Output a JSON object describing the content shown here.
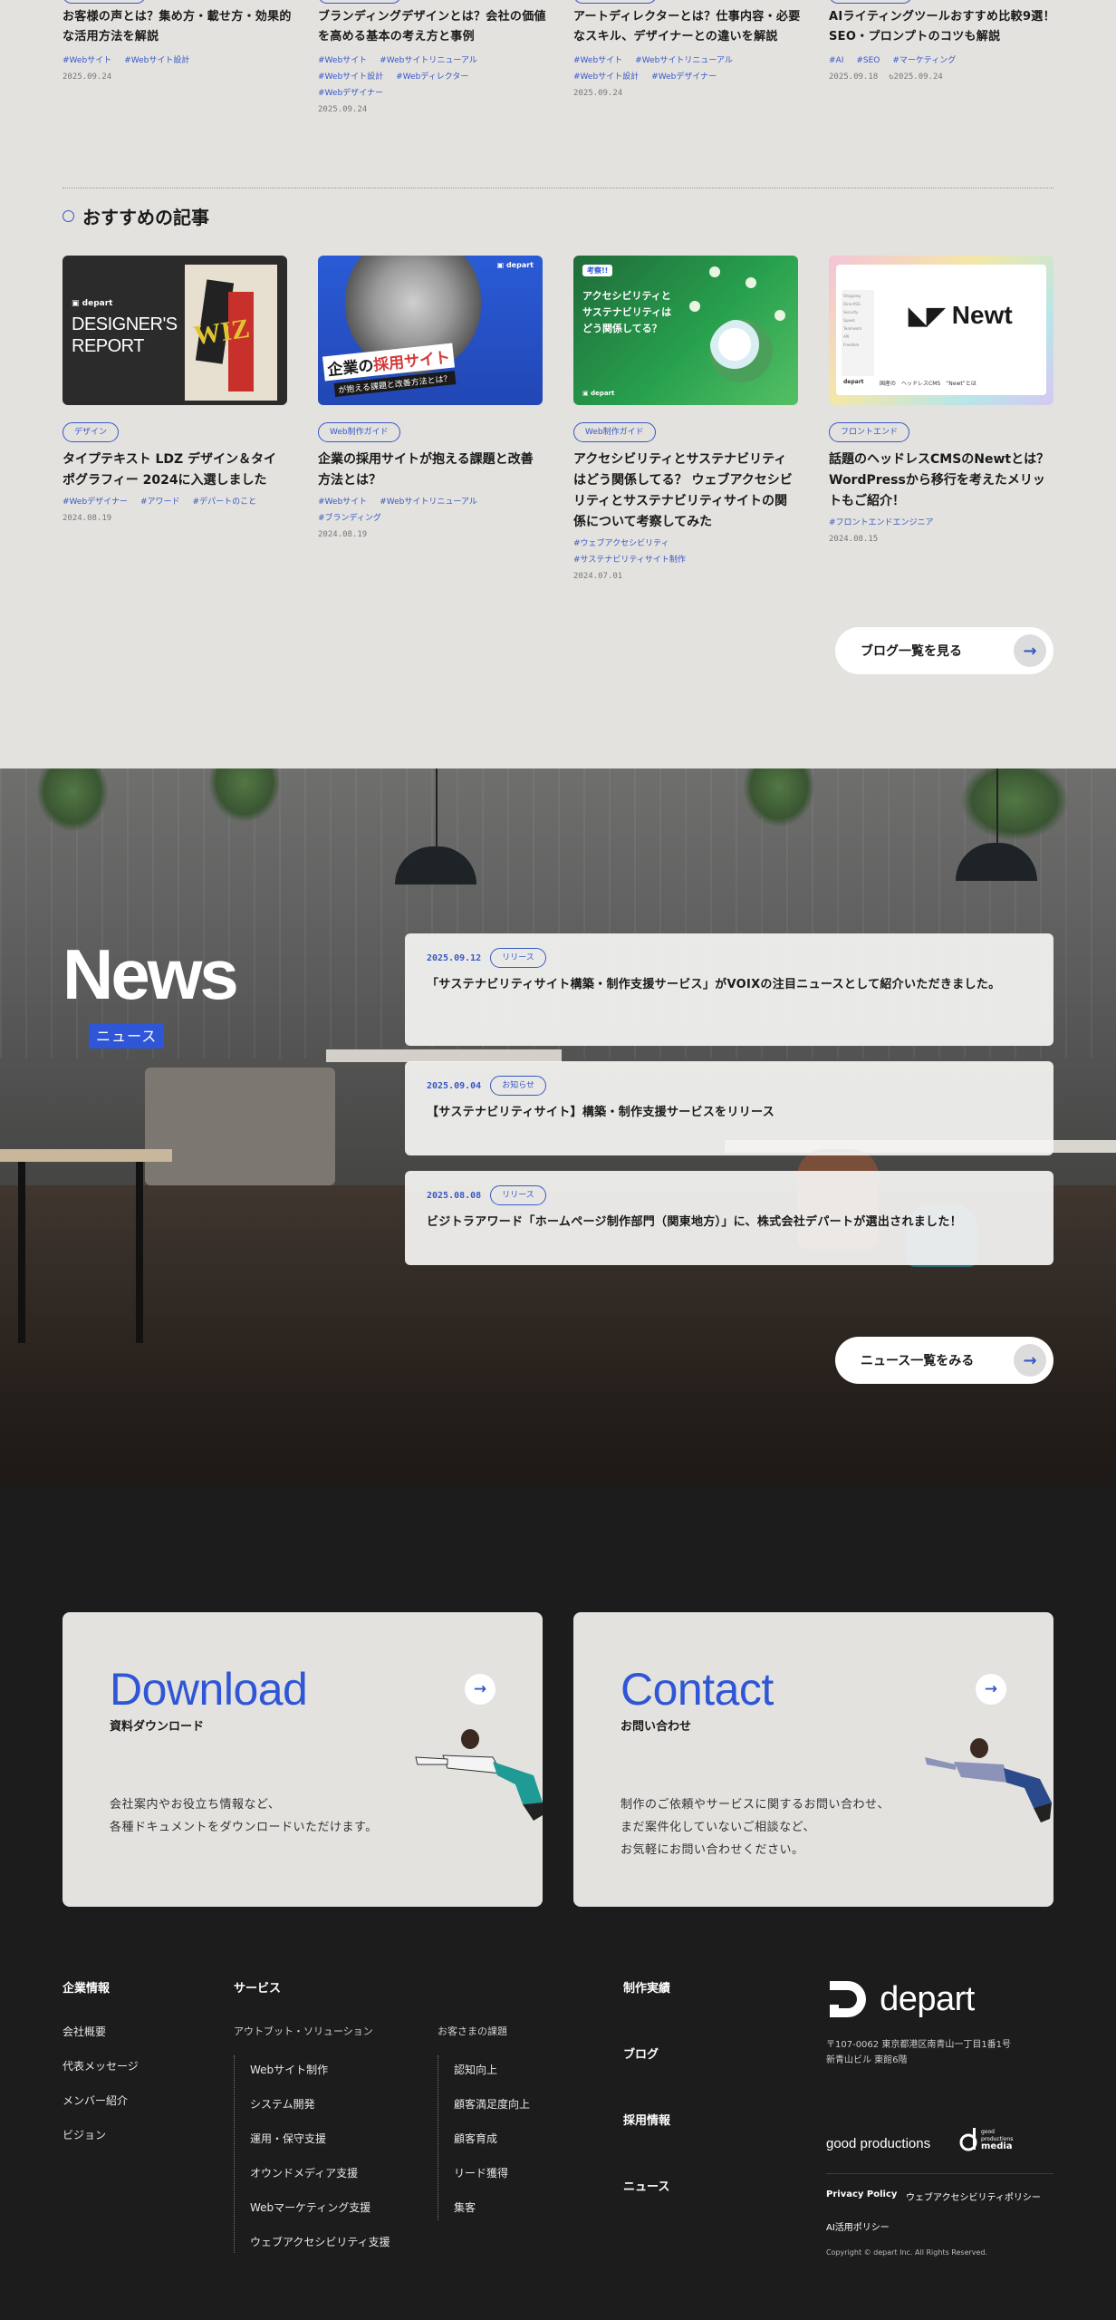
{
  "top_articles": [
    {
      "title": "お客様の声とは？集め方・載せ方・効果的な活用方法を解説",
      "tags": [
        "#Webサイト",
        "#Webサイト設計"
      ],
      "date": "2025.09.24",
      "updated": ""
    },
    {
      "title": "ブランディングデザインとは？会社の価値を高める基本の考え方と事例",
      "tags": [
        "#Webサイト",
        "#Webサイトリニューアル",
        "#Webサイト設計",
        "#Webディレクター",
        "#Webデザイナー"
      ],
      "date": "2025.09.24",
      "updated": ""
    },
    {
      "title": "アートディレクターとは？仕事内容・必要なスキル、デザイナーとの違いを解説",
      "tags": [
        "#Webサイト",
        "#Webサイトリニューアル",
        "#Webサイト設計",
        "#Webデザイナー"
      ],
      "date": "2025.09.24",
      "updated": ""
    },
    {
      "title": "AIライティングツールおすすめ比較9選！SEO・プロンプトのコツも解説",
      "tags": [
        "#AI",
        "#SEO",
        "#マーケティング"
      ],
      "date": "2025.09.18",
      "updated": "2025.09.24"
    }
  ],
  "recommended": {
    "heading": "おすすめの記事",
    "items": [
      {
        "category": "デザイン",
        "title": "タイプテキスト LDZ デザイン＆タイポグラフィー 2024に入選しました",
        "tags": [
          "#Webデザイナー",
          "#アワード",
          "#デパートのこと"
        ],
        "date": "2024.08.19",
        "thumb": {
          "logo": "depart",
          "line1": "DESIGNER'S",
          "line2": "REPORT",
          "poster": "WIZ"
        }
      },
      {
        "category": "Web制作ガイド",
        "title": "企業の採用サイトが抱える課題と改善方法とは？",
        "tags": [
          "#Webサイト",
          "#Webサイトリニューアル",
          "#ブランディング"
        ],
        "date": "2024.08.19",
        "thumb": {
          "logo": "depart",
          "line1": "企業の",
          "line2": "採用サイト",
          "line3": "が抱える課題と改善方法とは？"
        }
      },
      {
        "category": "Web制作ガイド",
        "title": "アクセシビリティとサステナビリティはどう関係してる？ ウェブアクセシビリティとサステナビリティサイトの関係について考察してみた",
        "tags": [
          "#ウェブアクセシビリティ",
          "#サステナビリティサイト制作"
        ],
        "date": "2024.07.01",
        "thumb": {
          "badge": "考察!!",
          "line1": "アクセシビリティと",
          "line2": "サステナビリティは",
          "line3": "どう関係してる？",
          "logo": "depart"
        }
      },
      {
        "category": "フロントエンド",
        "title": "話題のヘッドレスCMSのNewtとは？WordPressから移行を考えたメリットもご紹介！",
        "tags": [
          "#フロントエンドエンジニア"
        ],
        "date": "2024.08.15",
        "thumb": {
          "brand": "Newt",
          "caption": "国産の　ヘッドレスCMS　“Newt”とは",
          "logo": "depart",
          "menu": [
            "Shopping",
            "Dine-ASG",
            "Security",
            "Speed",
            "Teamwork",
            "API",
            "Freedom"
          ]
        }
      }
    ],
    "more_button": "ブログ一覧を見る"
  },
  "news": {
    "title": "News",
    "subtitle": "ニュース",
    "items": [
      {
        "date": "2025.09.12",
        "category": "リリース",
        "text": "「サステナビリティサイト構築・制作支援サービス」がVOIXの注目ニュースとして紹介いただきました。"
      },
      {
        "date": "2025.09.04",
        "category": "お知らせ",
        "text": "【サステナビリティサイト】構築・制作支援サービスをリリース"
      },
      {
        "date": "2025.08.08",
        "category": "リリース",
        "text": "ビジトラアワード「ホームページ制作部門（関東地方）」に、株式会社デパートが選出されました！"
      }
    ],
    "more_button": "ニュース一覧をみる"
  },
  "cta": {
    "download": {
      "title": "Download",
      "subtitle": "資料ダウンロード",
      "desc1": "会社案内やお役立ち情報など、",
      "desc2": "各種ドキュメントをダウンロードいただけます。"
    },
    "contact": {
      "title": "Contact",
      "subtitle": "お問い合わせ",
      "desc1": "制作のご依頼やサービスに関するお問い合わせ、",
      "desc2": "まだ案件化していないご相談など、",
      "desc3": "お気軽にお問い合わせください。"
    }
  },
  "footer": {
    "company": {
      "heading": "企業情報",
      "links": [
        "会社概要",
        "代表メッセージ",
        "メンバー紹介",
        "ビジョン"
      ]
    },
    "services": {
      "heading": "サービス",
      "outbound": {
        "heading": "アウトブット・ソリューション",
        "links": [
          "Webサイト制作",
          "システム開発",
          "運用・保守支援",
          "オウンドメディア支援",
          "Webマーケティング支援",
          "ウェブアクセシビリティ支援"
        ]
      },
      "issues": {
        "heading": "お客さまの課題",
        "links": [
          "認知向上",
          "顧客満足度向上",
          "顧客育成",
          "リード獲得",
          "集客"
        ]
      }
    },
    "main_links": [
      "制作実績",
      "ブログ",
      "採用情報",
      "ニュース"
    ],
    "brand": "depart",
    "address1": "〒107-0062 東京都港区南青山一丁目1番1号",
    "address2": "新青山ビル 東館6階",
    "partner1": "good productions",
    "partner2_a": "good",
    "partner2_b": "productions",
    "partner2_c": "media",
    "policy1": "Privacy Policy",
    "policy2": "ウェブアクセシビリティポリシー",
    "policy3": "AI活用ポリシー",
    "copyright": "Copyright © depart Inc. All Rights Reserved."
  },
  "colors": {
    "accent": "#2f56d6",
    "bg_light": "#e3e2de",
    "bg_dark": "#1c1c1c"
  }
}
